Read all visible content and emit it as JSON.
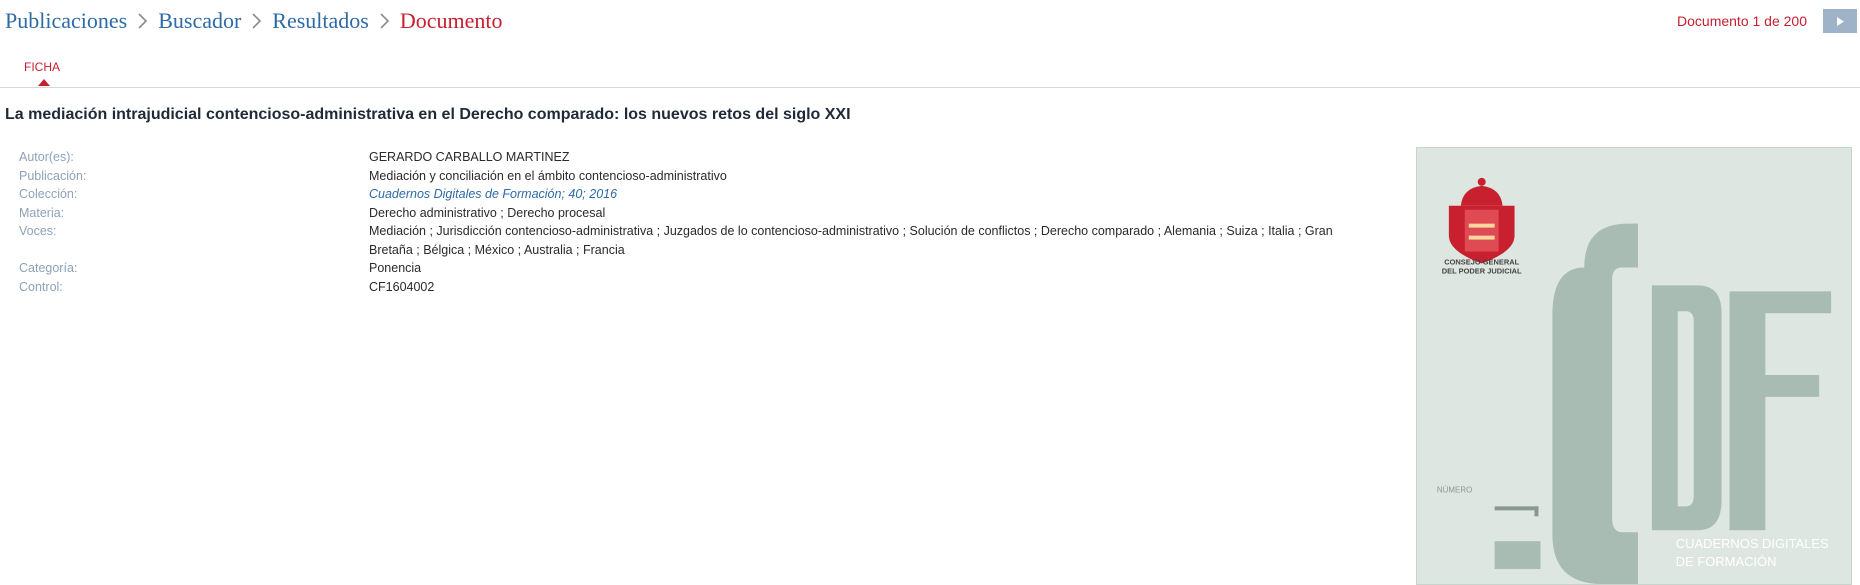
{
  "breadcrumb": {
    "items": [
      "Publicaciones",
      "Buscador",
      "Resultados"
    ],
    "current": "Documento"
  },
  "docnav": {
    "counter": "Documento 1 de 200",
    "next_icon": "caret-right-icon"
  },
  "tabs": [
    {
      "label": "FICHA",
      "active": true
    }
  ],
  "document": {
    "title": "La mediación intrajudicial contencioso-administrativa en el Derecho comparado: los nuevos retos del siglo XXI"
  },
  "metadata": [
    {
      "label": "Autor(es):",
      "value": "GERARDO CARBALLO MARTINEZ"
    },
    {
      "label": "Publicación:",
      "value": "Mediación y conciliación en el ámbito contencioso-administrativo"
    },
    {
      "label": "Colección:",
      "value": "Cuadernos Digitales de Formación; 40; 2016",
      "link": true
    },
    {
      "label": "Materia:",
      "value": "Derecho administrativo ; Derecho procesal"
    },
    {
      "label": "Voces:",
      "value": "Mediación ; Jurisdicción contencioso-administrativa ; Juzgados de lo contencioso-administrativo ; Solución de conflictos ; Derecho comparado ; Alemania ; Suiza ; Italia ; Gran Bretaña ; Bélgica ; México ; Australia ; Francia"
    },
    {
      "label": "Categoría:",
      "value": "Ponencia"
    },
    {
      "label": "Control:",
      "value": "CF1604002"
    }
  ],
  "cover": {
    "org_line1": "CONSEJO GENERAL",
    "org_line2": "DEL PODER JUDICIAL",
    "big_letters": "CDF",
    "numero_label": "NÚMERO",
    "series_line1": "CUADERNOS DIGITALES",
    "series_line2": "DE FORMACIÓN",
    "colors": {
      "background": "#dde6e1",
      "letters": "#a9bcb3",
      "crest": "#c8202f"
    }
  },
  "colors": {
    "link": "#2e6aa6",
    "accent": "#c8202f",
    "label": "#8da3b8",
    "nav_button": "#9fb3c8"
  }
}
